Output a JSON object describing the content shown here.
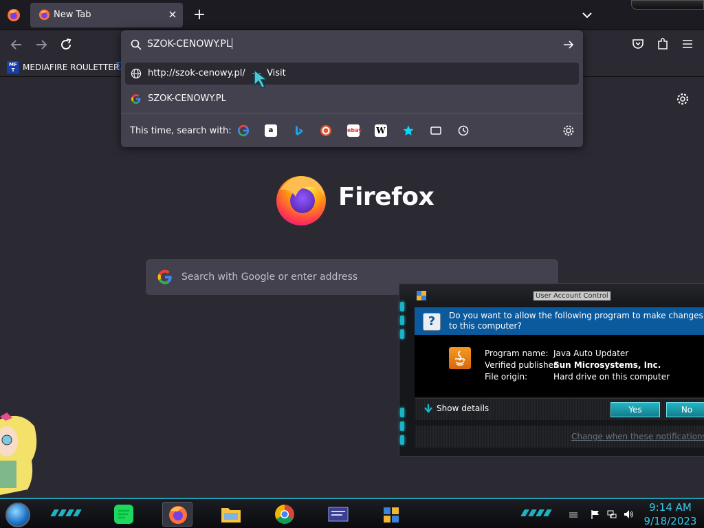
{
  "browser": {
    "tab": {
      "title": "New Tab",
      "close": "×"
    },
    "new_tab": "+",
    "bookmarks": [
      {
        "label": "MEDIAFIRE ROULETTER",
        "icon_text": "MF T"
      }
    ]
  },
  "urlbar": {
    "value": "SZOK-CENOWY.PL",
    "suggestions": [
      {
        "text": "http://szok-cenowy.pl/",
        "separator": "—",
        "action": "Visit",
        "icon": "globe-icon",
        "selected": true
      },
      {
        "text": "SZOK-CENOWY.PL",
        "icon": "google-icon",
        "selected": false
      }
    ],
    "oneoff_label": "This time, search with:",
    "engines": [
      "google",
      "amazon",
      "bing",
      "duckduckgo",
      "ebay",
      "wikipedia",
      "bookmarks",
      "tabs",
      "history"
    ]
  },
  "newtab": {
    "brand": "Firefox",
    "search_placeholder": "Search with Google or enter address"
  },
  "uac": {
    "title": "User Account Control",
    "question": "Do you want to allow the following program to make changes to this computer?",
    "fields": [
      {
        "key": "Program name:",
        "value": "Java Auto Updater",
        "bold": false
      },
      {
        "key": "Verified publisher:",
        "value": "Sun Microsystems, Inc.",
        "bold": true
      },
      {
        "key": "File origin:",
        "value": "Hard drive on this computer",
        "bold": false
      }
    ],
    "show_details": "Show details",
    "yes": "Yes",
    "no": "No",
    "change_link": "Change when these notifications appear"
  },
  "taskbar": {
    "time": "9:14 AM",
    "date": "9/18/2023",
    "apps": [
      "spotify",
      "firefox",
      "file-explorer",
      "chrome",
      "control-panel",
      "program-manager"
    ]
  },
  "colors": {
    "accent": "#1ab3c6",
    "uac_header": "#0c5a9e",
    "clock": "#39c7e8"
  }
}
